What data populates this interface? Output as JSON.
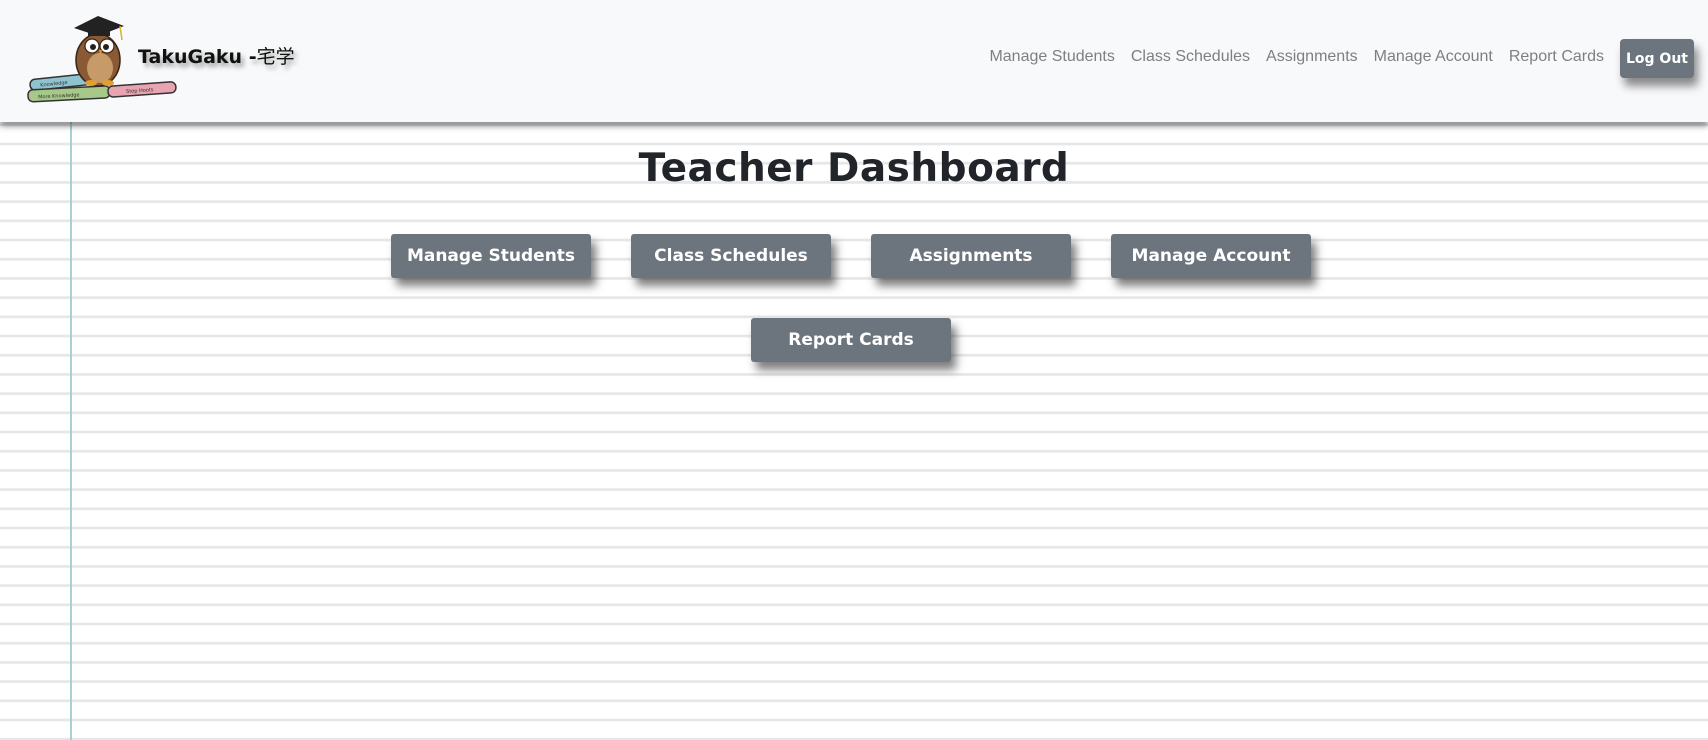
{
  "brand": {
    "name": "TakuGaku -",
    "name_jp": "宅学"
  },
  "nav": {
    "links": [
      "Manage Students",
      "Class Schedules",
      "Assignments",
      "Manage Account",
      "Report Cards"
    ],
    "logout_label": "Log Out"
  },
  "main": {
    "title": "Teacher Dashboard",
    "buttons": [
      "Manage Students",
      "Class Schedules",
      "Assignments",
      "Manage Account",
      "Report Cards"
    ]
  },
  "colors": {
    "button_bg": "#6c757d",
    "navbar_bg": "#f8f9fa",
    "margin_line": "#a9d0d6"
  }
}
